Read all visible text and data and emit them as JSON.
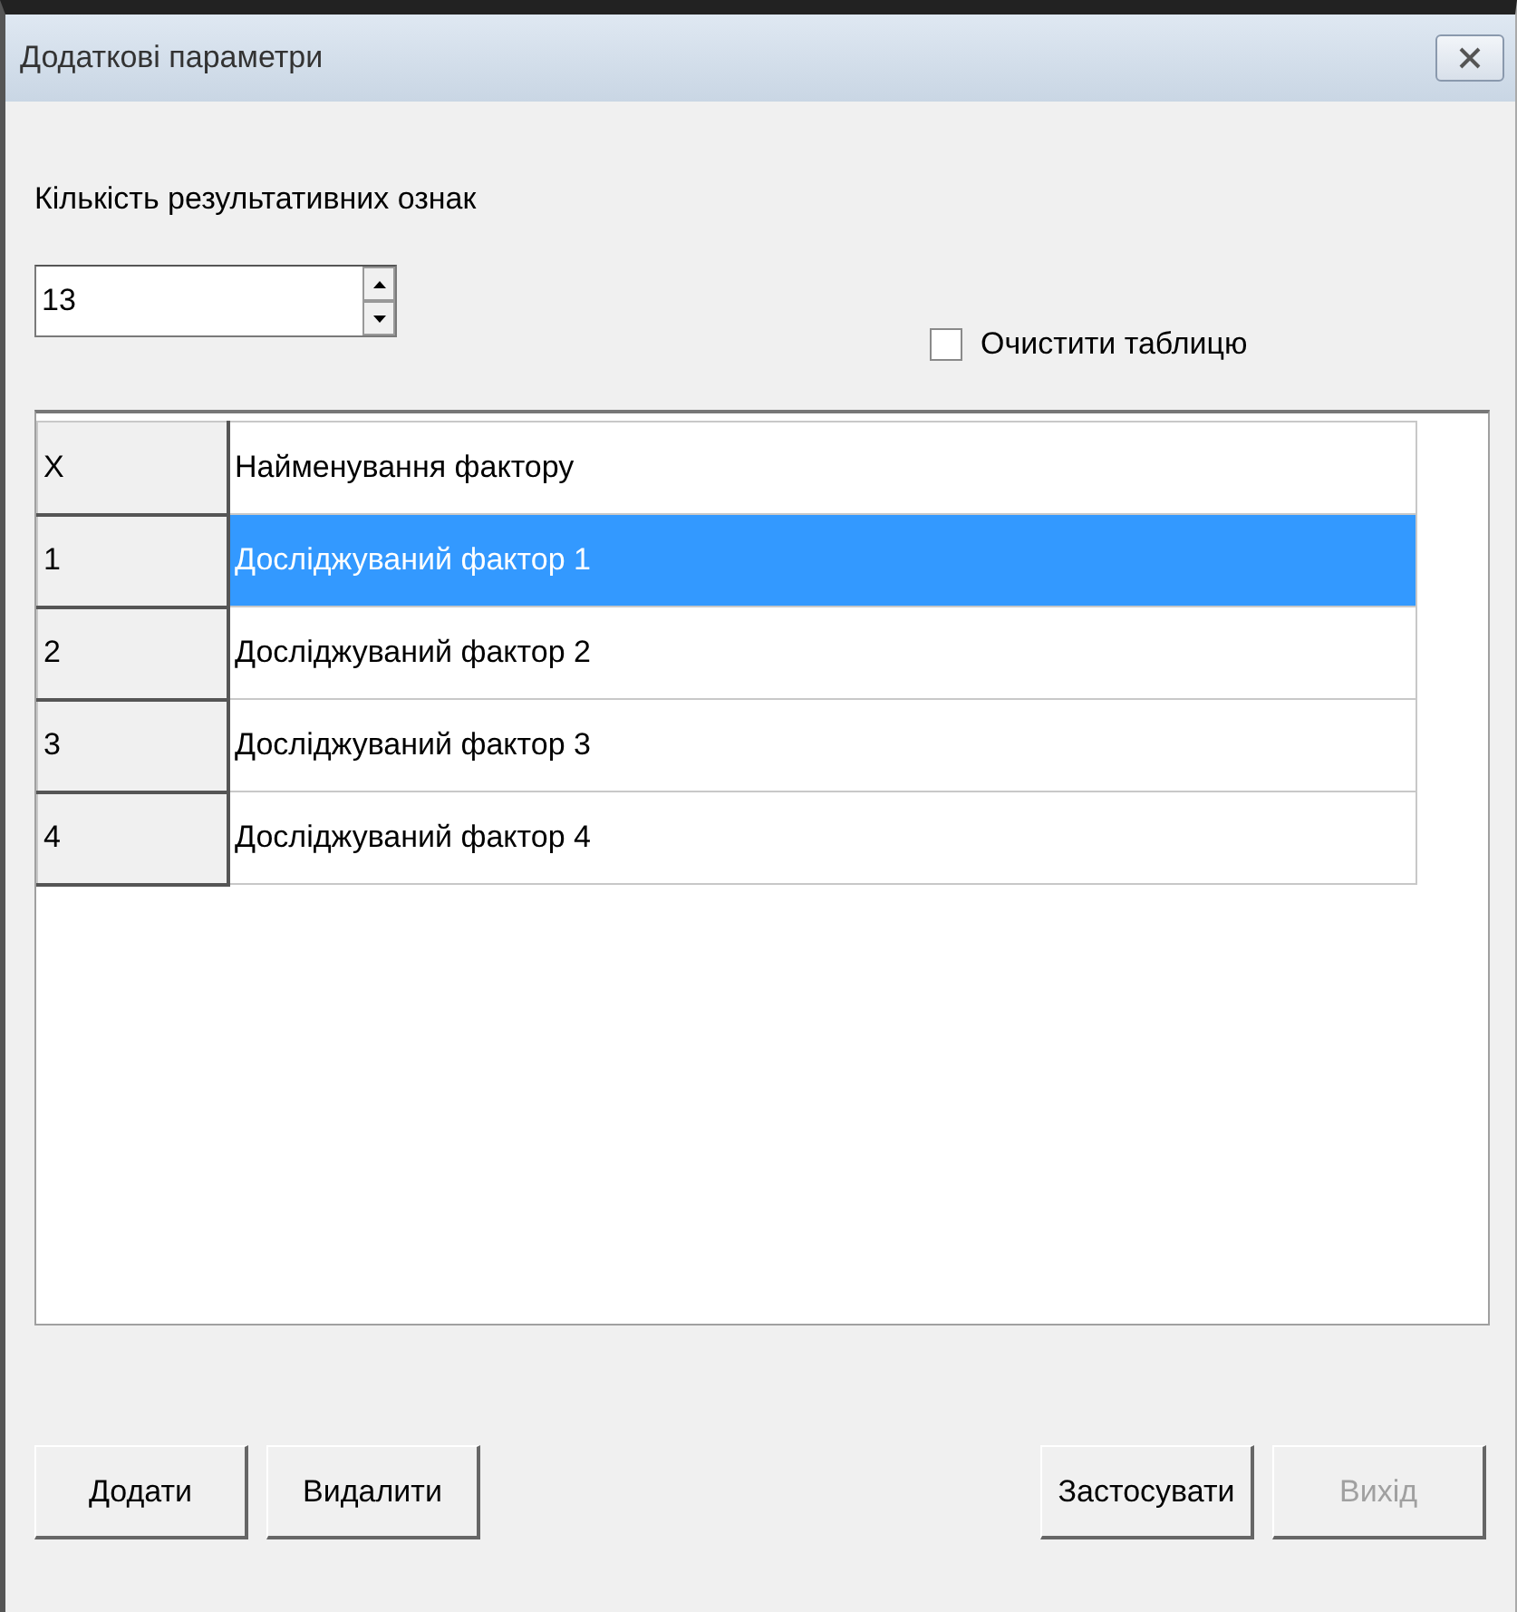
{
  "window": {
    "title": "Додаткові параметри"
  },
  "result_count": {
    "label": "Кількість результативних ознак",
    "value": "13"
  },
  "clear_table": {
    "label": "Очистити таблицю",
    "checked": false
  },
  "table": {
    "columns": [
      "X",
      "Найменування фактору"
    ],
    "rows": [
      {
        "cells": [
          "1",
          "Досліджуваний фактор 1"
        ],
        "selected": true
      },
      {
        "cells": [
          "2",
          "Досліджуваний фактор 2"
        ],
        "selected": false
      },
      {
        "cells": [
          "3",
          "Досліджуваний фактор 3"
        ],
        "selected": false
      },
      {
        "cells": [
          "4",
          "Досліджуваний фактор 4"
        ],
        "selected": false
      }
    ]
  },
  "left_buttons": [
    {
      "label": "Додати",
      "disabled": false
    },
    {
      "label": "Видалити",
      "disabled": false
    }
  ],
  "right_buttons": [
    {
      "label": "Застосувати",
      "disabled": false
    },
    {
      "label": "Вихід",
      "disabled": true
    }
  ]
}
